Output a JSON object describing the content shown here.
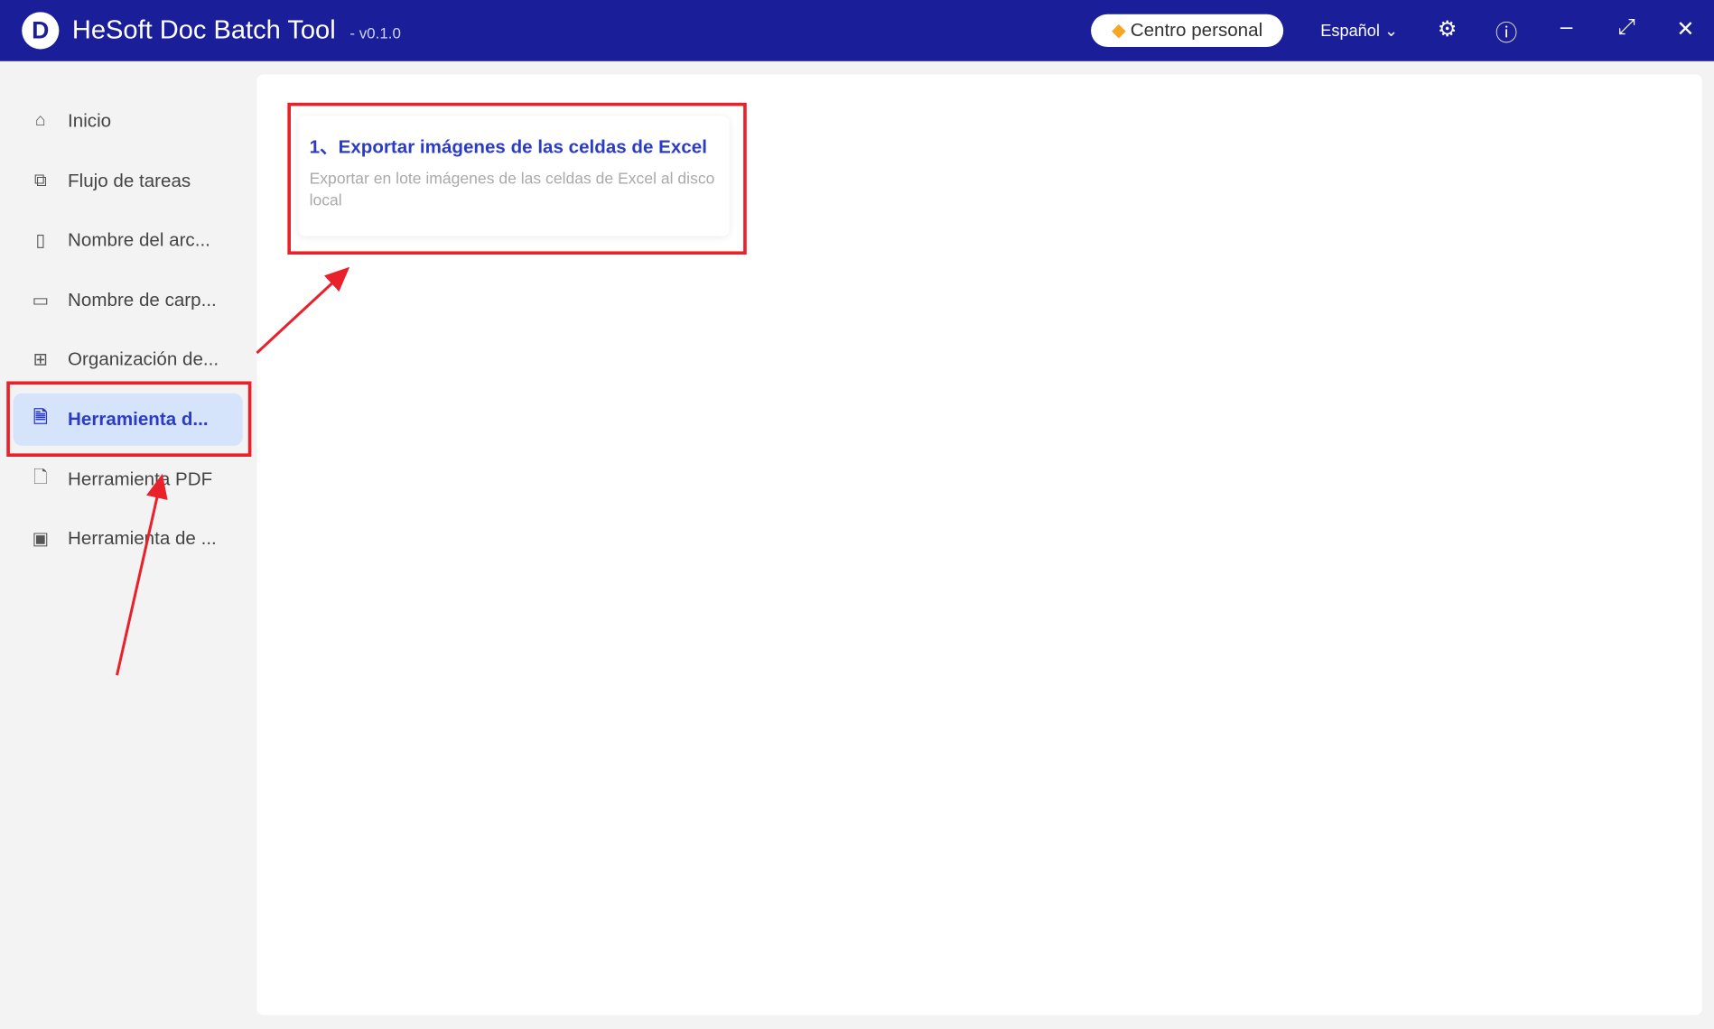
{
  "header": {
    "logo": "D",
    "title": "HeSoft Doc Batch Tool",
    "version": "- v0.1.0",
    "personal_center": "Centro personal",
    "language": "Español"
  },
  "sidebar": {
    "items": [
      {
        "label": "Inicio",
        "icon": "home-icon"
      },
      {
        "label": "Flujo de tareas",
        "icon": "workflow-icon"
      },
      {
        "label": "Nombre del arc...",
        "icon": "file-icon"
      },
      {
        "label": "Nombre de carp...",
        "icon": "folder-icon"
      },
      {
        "label": "Organización de...",
        "icon": "organize-icon"
      },
      {
        "label": "Herramienta d...",
        "icon": "excel-file-icon",
        "active": true
      },
      {
        "label": "Herramienta PDF",
        "icon": "pdf-icon"
      },
      {
        "label": "Herramienta de ...",
        "icon": "image-icon"
      }
    ]
  },
  "main": {
    "cards": [
      {
        "title": "1、Exportar imágenes de las celdas de Excel",
        "description": "Exportar en lote imágenes de las celdas de Excel al disco local"
      }
    ]
  },
  "colors": {
    "header": "#1a1f99",
    "accent": "#2b3bc6",
    "highlight": "#e8212b"
  }
}
